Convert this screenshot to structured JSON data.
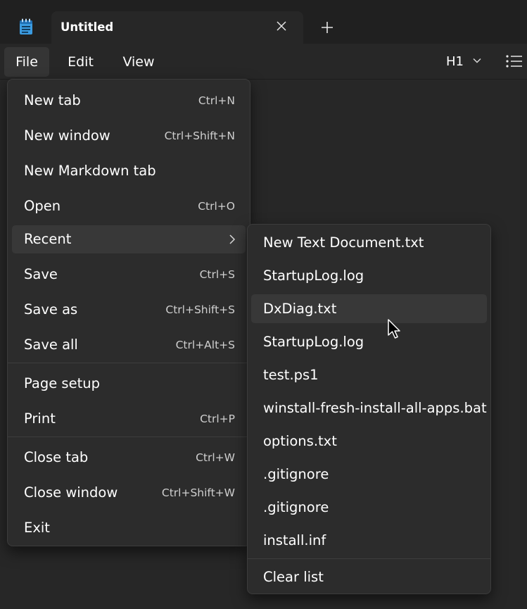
{
  "window": {
    "tab_title": "Untitled",
    "app_icon": "notepad-icon",
    "close_tab_icon": "close-icon",
    "new_tab_icon": "plus-icon"
  },
  "menubar": {
    "items": [
      {
        "label": "File",
        "active": true
      },
      {
        "label": "Edit",
        "active": false
      },
      {
        "label": "View",
        "active": false
      }
    ],
    "heading_select": "H1",
    "list_icon": "bulleted-list-icon"
  },
  "file_menu": {
    "items": [
      {
        "label": "New tab",
        "shortcut": "Ctrl+N"
      },
      {
        "label": "New window",
        "shortcut": "Ctrl+Shift+N"
      },
      {
        "label": "New Markdown tab",
        "shortcut": ""
      },
      {
        "label": "Open",
        "shortcut": "Ctrl+O"
      },
      {
        "label": "Recent",
        "shortcut": "",
        "submenu": true,
        "highlighted": true
      },
      {
        "label": "Save",
        "shortcut": "Ctrl+S"
      },
      {
        "label": "Save as",
        "shortcut": "Ctrl+Shift+S"
      },
      {
        "label": "Save all",
        "shortcut": "Ctrl+Alt+S"
      },
      {
        "label": "Page setup",
        "shortcut": ""
      },
      {
        "label": "Print",
        "shortcut": "Ctrl+P"
      },
      {
        "label": "Close tab",
        "shortcut": "Ctrl+W"
      },
      {
        "label": "Close window",
        "shortcut": "Ctrl+Shift+W"
      },
      {
        "label": "Exit",
        "shortcut": ""
      }
    ]
  },
  "recent_menu": {
    "items": [
      {
        "label": "New Text Document.txt"
      },
      {
        "label": "StartupLog.log"
      },
      {
        "label": "DxDiag.txt",
        "highlighted": true
      },
      {
        "label": "StartupLog.log"
      },
      {
        "label": "test.ps1"
      },
      {
        "label": "winstall-fresh-install-all-apps.bat"
      },
      {
        "label": "options.txt"
      },
      {
        "label": ".gitignore"
      },
      {
        "label": ".gitignore"
      },
      {
        "label": "install.inf"
      }
    ],
    "clear_label": "Clear list"
  },
  "colors": {
    "background": "#202020",
    "menu_bg": "#2c2c2c",
    "highlight": "#383838",
    "text": "#ffffff",
    "shortcut_text": "#cfcfcf"
  }
}
